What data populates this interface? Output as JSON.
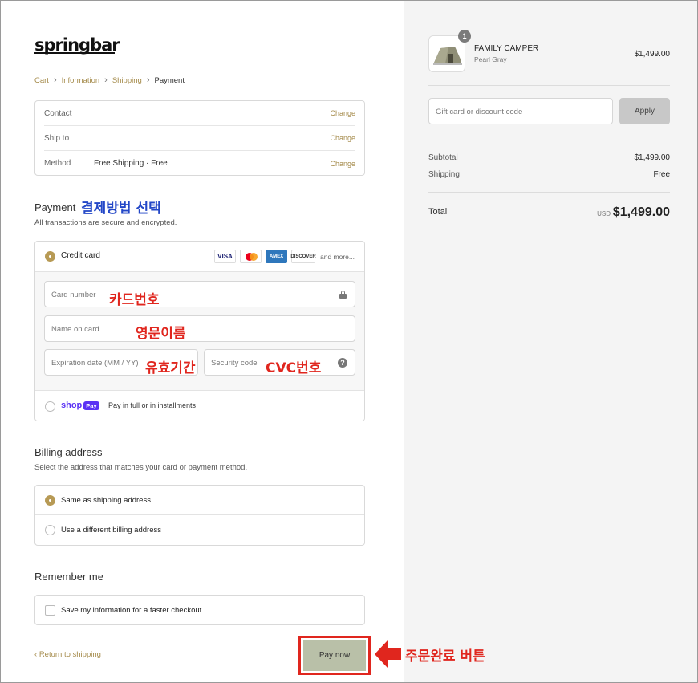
{
  "brand": {
    "logo_text": "springbar"
  },
  "breadcrumb": [
    {
      "label": "Cart"
    },
    {
      "label": "Information"
    },
    {
      "label": "Shipping"
    },
    {
      "label": "Payment"
    }
  ],
  "review": {
    "contact_label": "Contact",
    "contact_value": "",
    "shipto_label": "Ship to",
    "shipto_value": "",
    "method_label": "Method",
    "method_value": "Free Shipping · Free",
    "change_label": "Change"
  },
  "payment": {
    "heading": "Payment",
    "annotation": "결제방법 선택",
    "subtitle": "All transactions are secure and encrypted.",
    "credit_card_label": "Credit card",
    "brands": [
      "VISA",
      "MC",
      "AMEX",
      "DISCOVER"
    ],
    "more_label": "and more...",
    "fields": {
      "card_number": "Card number",
      "name_on_card": "Name on card",
      "expiration": "Expiration date (MM / YY)",
      "security_code": "Security code"
    },
    "annotations": {
      "card_number": "카드번호",
      "name_on_card": "영문이름",
      "expiration": "유효기간",
      "security_code": "CVC번호"
    },
    "shop_logo": "shop",
    "shop_pay_badge": "Pay",
    "shop_text": "Pay in full or in installments"
  },
  "billing": {
    "heading": "Billing address",
    "subtitle": "Select the address that matches your card or payment method.",
    "same": "Same as shipping address",
    "different": "Use a different billing address"
  },
  "remember": {
    "heading": "Remember me",
    "checkbox_label": "Save my information for a faster checkout"
  },
  "footer": {
    "return_label": "Return to shipping",
    "pay_now": "Pay now",
    "annotation": "주문완료 버튼"
  },
  "summary": {
    "product_name": "FAMILY CAMPER",
    "product_variant": "Pearl Gray",
    "product_price": "$1,499.00",
    "quantity": "1",
    "gift_placeholder": "Gift card or discount code",
    "apply_label": "Apply",
    "subtotal_label": "Subtotal",
    "subtotal_value": "$1,499.00",
    "shipping_label": "Shipping",
    "shipping_value": "Free",
    "total_label": "Total",
    "total_currency": "USD",
    "total_value": "$1,499.00"
  },
  "colors": {
    "accent": "#a58b4b",
    "radio_selected": "#b79a55",
    "annotation_red": "#e0261e",
    "annotation_blue": "#2347c7",
    "pay_button": "#b9c0a8"
  }
}
